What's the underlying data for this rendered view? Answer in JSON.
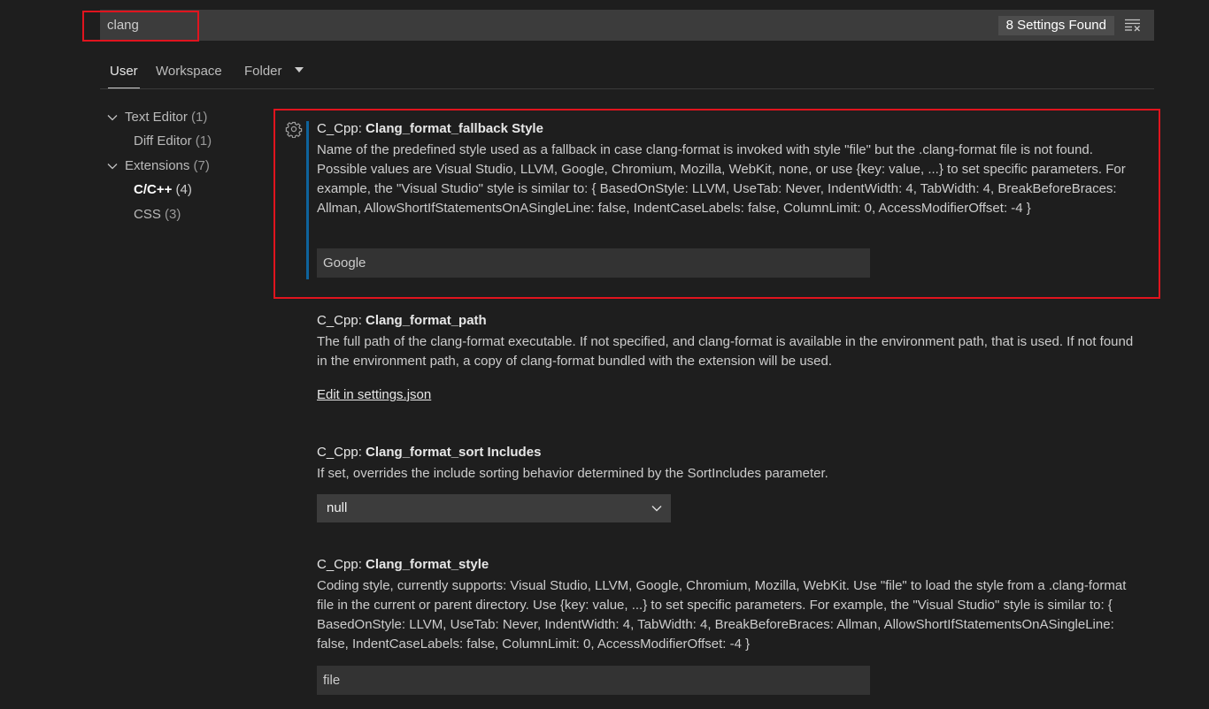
{
  "search": {
    "value": "clang",
    "results_label": "8 Settings Found",
    "clear_icon": "clear-filter-icon"
  },
  "tabs": {
    "user": "User",
    "workspace": "Workspace",
    "folder": "Folder"
  },
  "toc": {
    "text_editor": {
      "label": "Text Editor",
      "count": "(1)"
    },
    "diff_editor": {
      "label": "Diff Editor",
      "count": "(1)"
    },
    "extensions": {
      "label": "Extensions",
      "count": "(7)"
    },
    "cpp": {
      "label": "C/C++",
      "count": "(4)"
    },
    "css": {
      "label": "CSS",
      "count": "(3)"
    }
  },
  "settings": [
    {
      "prefix": "C_Cpp: ",
      "key": "Clang_format_fallback Style",
      "description": "Name of the predefined style used as a fallback in case clang-format is invoked with style \"file\" but the .clang-format file is not found. Possible values are Visual Studio, LLVM, Google, Chromium, Mozilla, WebKit, none, or use {key: value, ...} to set specific parameters. For example, the \"Visual Studio\" style is similar to: { BasedOnStyle: LLVM, UseTab: Never, IndentWidth: 4, TabWidth: 4, BreakBeforeBraces: Allman, AllowShortIfStatementsOnASingleLine: false, IndentCaseLabels: false, ColumnLimit: 0, AccessModifierOffset: -4 }",
      "value": "Google"
    },
    {
      "prefix": "C_Cpp: ",
      "key": "Clang_format_path",
      "description": "The full path of the clang-format executable. If not specified, and clang-format is available in the environment path, that is used. If not found in the environment path, a copy of clang-format bundled with the extension will be used.",
      "link": "Edit in settings.json"
    },
    {
      "prefix": "C_Cpp: ",
      "key": "Clang_format_sort Includes",
      "description": "If set, overrides the include sorting behavior determined by the SortIncludes parameter.",
      "value": "null"
    },
    {
      "prefix": "C_Cpp: ",
      "key": "Clang_format_style",
      "description": "Coding style, currently supports: Visual Studio, LLVM, Google, Chromium, Mozilla, WebKit. Use \"file\" to load the style from a .clang-format file in the current or parent directory. Use {key: value, ...} to set specific parameters. For example, the \"Visual Studio\" style is similar to: { BasedOnStyle: LLVM, UseTab: Never, IndentWidth: 4, TabWidth: 4, BreakBeforeBraces: Allman, AllowShortIfStatementsOnASingleLine: false, IndentCaseLabels: false, ColumnLimit: 0, AccessModifierOffset: -4 }",
      "value": "file"
    }
  ],
  "colors": {
    "background": "#1e1e1e",
    "highlight_border": "#e0141e",
    "focus_bar": "#0e639c"
  }
}
